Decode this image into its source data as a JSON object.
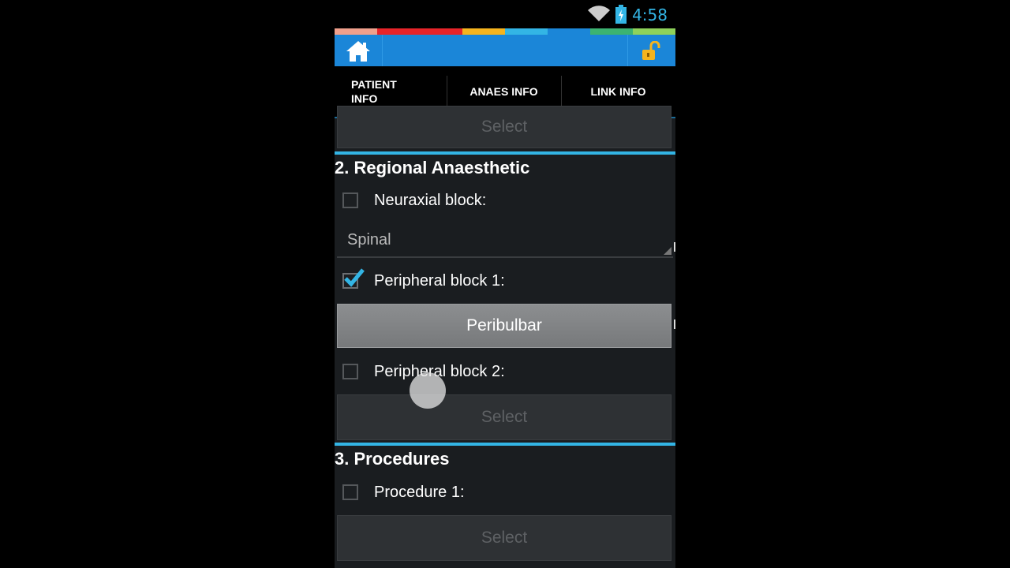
{
  "status_bar": {
    "time": "4:58",
    "wifi_icon": "wifi-icon",
    "battery_icon": "battery-charging-icon"
  },
  "color_strip": [
    "#f0a08c",
    "#e8242a",
    "#e8242a",
    "#f5b41e",
    "#33b5e5",
    "#1b86d8",
    "#3cb371",
    "#8ed25a"
  ],
  "action_bar": {
    "home_icon": "home-icon",
    "lock_icon": "unlock-icon",
    "background": "#1b86d8"
  },
  "tabs": [
    {
      "label": "PATIENT\nINFO",
      "active": false
    },
    {
      "label": "ANAES INFO",
      "active": true
    },
    {
      "label": "LINK INFO",
      "active": false
    }
  ],
  "sections": {
    "top_select": "Select",
    "regional": {
      "title": "2. Regional Anaesthetic",
      "neuraxial": {
        "label": "Neuraxial block:",
        "checked": false,
        "value": "Spinal"
      },
      "peripheral1": {
        "label": "Peripheral block 1:",
        "checked": true,
        "value": "Peribulbar"
      },
      "peripheral2": {
        "label": "Peripheral block 2:",
        "checked": false,
        "value": "Select"
      }
    },
    "procedures": {
      "title": "3. Procedures",
      "procedure1": {
        "label": "Procedure 1:",
        "checked": false,
        "value": "Select"
      }
    }
  },
  "accent_color": "#33b5e5"
}
